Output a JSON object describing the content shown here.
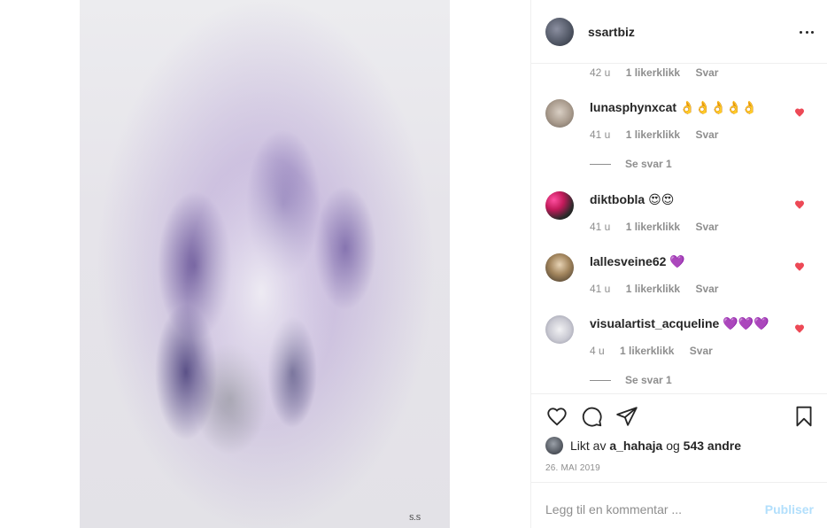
{
  "post": {
    "username": "ssartbiz",
    "image_alt": "Abstract purple painting",
    "signature": "S.S"
  },
  "comments": {
    "top_meta": {
      "age": "42 u",
      "likes": "1 likerklikk",
      "reply": "Svar"
    },
    "items": [
      {
        "username": "lunasphynxcat",
        "text": "👌👌👌👌👌",
        "age": "41 u",
        "likes": "1 likerklikk",
        "reply": "Svar",
        "liked": true,
        "view_replies": "Se svar 1"
      },
      {
        "username": "diktbobla",
        "text": "😍😍",
        "age": "41 u",
        "likes": "1 likerklikk",
        "reply": "Svar",
        "liked": true
      },
      {
        "username": "lallesveine62",
        "text": "💜",
        "age": "41 u",
        "likes": "1 likerklikk",
        "reply": "Svar",
        "liked": true
      },
      {
        "username": "visualartist_acqueline",
        "text": "💜💜💜",
        "age": "4 u",
        "likes": "1 likerklikk",
        "reply": "Svar",
        "liked": true,
        "view_replies": "Se svar 1"
      }
    ]
  },
  "actions": {
    "like_icon": "heart-icon",
    "comment_icon": "comment-icon",
    "share_icon": "paper-plane-icon",
    "save_icon": "bookmark-icon"
  },
  "likes": {
    "prefix": "Likt av",
    "user": "a_hahaja",
    "joiner": "og",
    "others": "543 andre"
  },
  "date": "26. MAI 2019",
  "add_comment": {
    "placeholder": "Legg til en kommentar ...",
    "publish_label": "Publiser"
  },
  "colors": {
    "heart_red": "#ed4956",
    "muted_text": "#8e8e8e",
    "publish_disabled": "#b2dffc"
  }
}
